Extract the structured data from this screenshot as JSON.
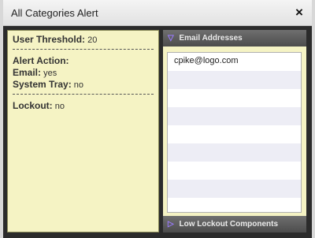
{
  "dialog": {
    "title": "All Categories Alert",
    "close_glyph": "×"
  },
  "info": {
    "user_threshold_label": "User Threshold:",
    "user_threshold_value": "20",
    "separator": "-----------------------------",
    "alert_action_label": "Alert Action:",
    "email_label": "Email:",
    "email_value": "yes",
    "system_tray_label": "System Tray:",
    "system_tray_value": "no",
    "lockout_label": "Lockout:",
    "lockout_value": "no"
  },
  "email_section": {
    "header": "Email Addresses",
    "expanded_icon": "▽",
    "rows": [
      "cpike@logo.com",
      "",
      "",
      "",
      "",
      "",
      "",
      "",
      ""
    ]
  },
  "lockout_section": {
    "header": "Low Lockout Components",
    "collapsed_icon": "▷"
  },
  "colors": {
    "panel_bg": "#f5f3c4",
    "header_bg": "#5c5c5c",
    "accent_triangle": "#9b7bff"
  }
}
